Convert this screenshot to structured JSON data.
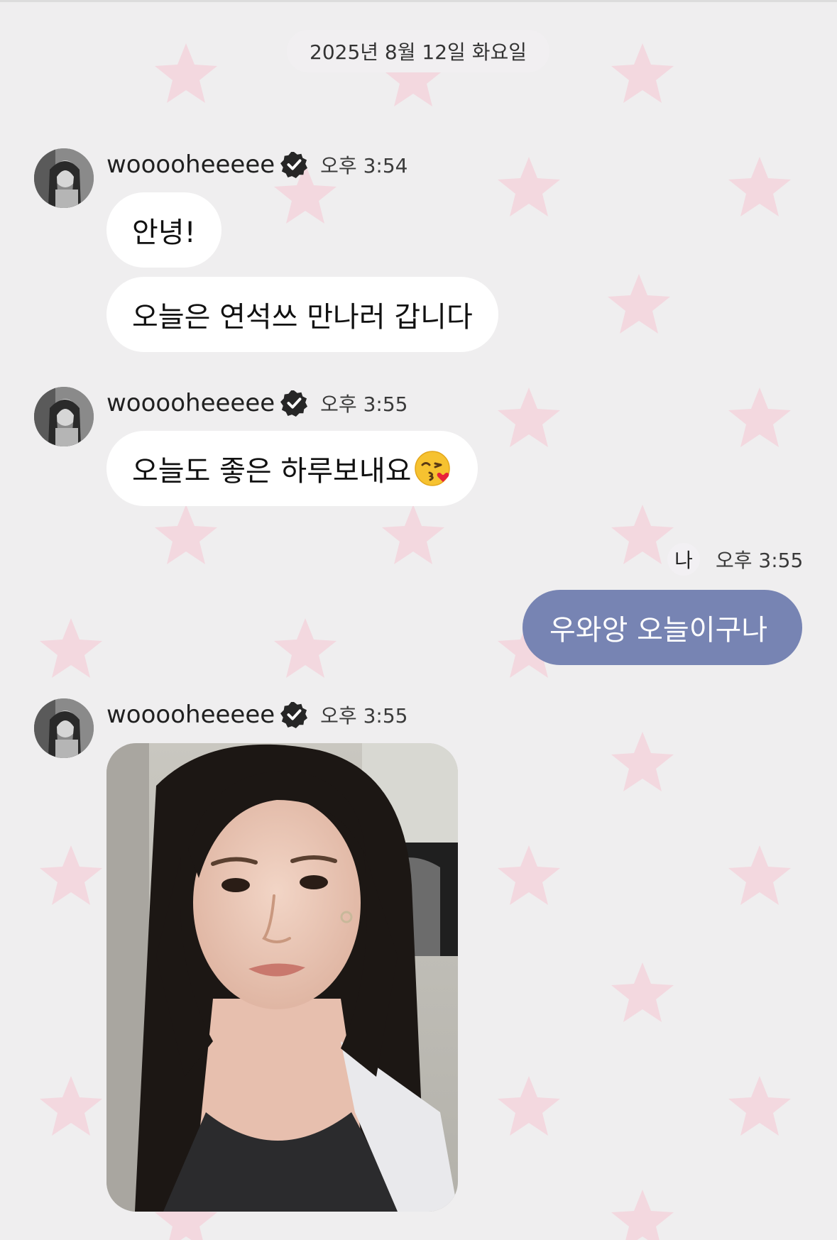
{
  "date_header": "2025년 8월 12일 화요일",
  "colors": {
    "background": "#efeeef",
    "bubble_incoming": "#ffffff",
    "bubble_outgoing": "#7784b3",
    "star_pattern": "#f3d8df"
  },
  "groups": [
    {
      "sender": "wooooheeeee",
      "verified_icon": "verified-badge-icon",
      "time": "오후 3:54",
      "messages": [
        "안녕!",
        "오늘은 연석쓰 만나러 갑니다"
      ]
    },
    {
      "sender": "wooooheeeee",
      "verified_icon": "verified-badge-icon",
      "time": "오후 3:55",
      "messages": [
        "오늘도 좋은 하루보내요"
      ],
      "emoji": "kissing-face-with-heart-emoji"
    },
    {
      "sender": "wooooheeeee",
      "verified_icon": "verified-badge-icon",
      "time": "오후 3:55",
      "attachment": "photo"
    }
  ],
  "outgoing": {
    "me_label": "나",
    "time": "오후 3:55",
    "message": "우와앙 오늘이구나"
  }
}
